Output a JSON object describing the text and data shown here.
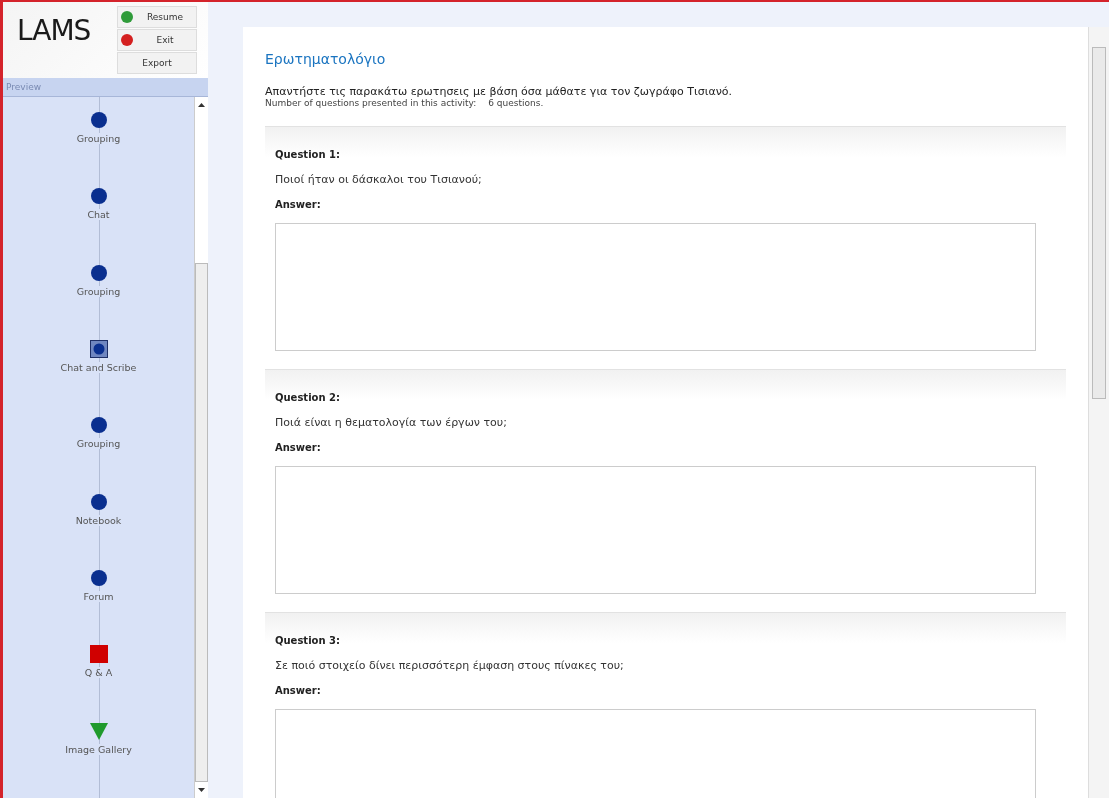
{
  "logo": "LAMS",
  "controls": [
    {
      "label": "Resume",
      "kind": "resume"
    },
    {
      "label": "Exit",
      "kind": "exit"
    },
    {
      "label": "Export",
      "kind": "plain"
    }
  ],
  "sidebar": {
    "title": "Preview",
    "items": [
      {
        "label": "Grouping",
        "kind": "circle"
      },
      {
        "label": "Chat",
        "kind": "circle"
      },
      {
        "label": "Grouping",
        "kind": "circle"
      },
      {
        "label": "Chat and Scribe",
        "kind": "framed"
      },
      {
        "label": "Grouping",
        "kind": "circle"
      },
      {
        "label": "Notebook",
        "kind": "circle"
      },
      {
        "label": "Forum",
        "kind": "circle"
      },
      {
        "label": "Q & A",
        "kind": "square"
      },
      {
        "label": "Image Gallery",
        "kind": "triangle"
      }
    ]
  },
  "page": {
    "title": "Ερωτηματολόγιο",
    "instructions": "Απαντήστε τις παρακάτω ερωτησεις με βάση όσα μάθατε για τον ζωγράφο Τισιανό.",
    "count_label": "Number of questions presented in this activity:",
    "count_value": "6 questions.",
    "questions": [
      {
        "label": "Question 1:",
        "text": "Ποιοί ήταν οι δάσκαλοι του Τισιανού;",
        "answer_label": "Answer:"
      },
      {
        "label": "Question 2:",
        "text": "Ποιά είναι η θεματολογία των έργων του;",
        "answer_label": "Answer:"
      },
      {
        "label": "Question 3:",
        "text": "Σε ποιό στοιχείο δίνει περισσότερη έμφαση στους πίνακες του;",
        "answer_label": "Answer:"
      }
    ]
  }
}
